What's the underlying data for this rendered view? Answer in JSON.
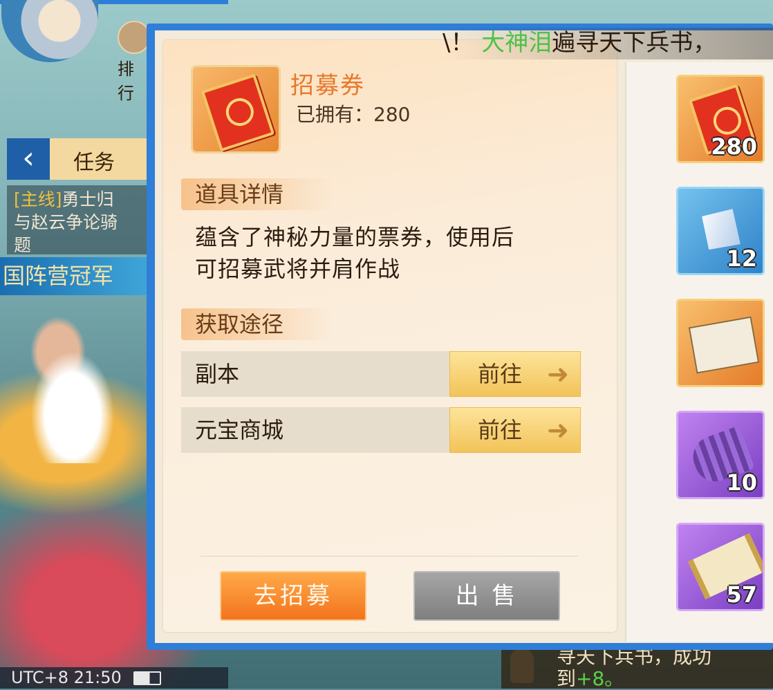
{
  "background": {
    "rank_label": "排行",
    "quest_tab_label": "任务",
    "quest_text_tag": "[主线]",
    "quest_text_line1": "勇士归",
    "quest_text_line2": "与赵云争论骑",
    "quest_text_line3": "题",
    "camp_banner": "国阵营冠军",
    "status_time": "UTC+8 21:50",
    "chat_text_line1": "寻天下兵书，成功",
    "chat_text_line2_prefix": "到",
    "chat_text_line2_value": "+8。"
  },
  "marquee": {
    "prefix": "\\！",
    "player_name": "大神泪",
    "message": "遍寻天下兵书，"
  },
  "item": {
    "name": "招募券",
    "owned_label": "已拥有：",
    "owned_count": "280",
    "detail_heading": "道具详情",
    "description_line1": "蕴含了神秘力量的票券，使用后",
    "description_line2": "可招募武将并肩作战",
    "source_heading": "获取途径",
    "routes": [
      {
        "name": "副本",
        "action": "前往"
      },
      {
        "name": "元宝商城",
        "action": "前往"
      }
    ]
  },
  "buttons": {
    "recruit": "去招募",
    "sell": "出 售"
  },
  "inventory": [
    {
      "icon": "recruit-ticket-icon",
      "count": "280",
      "rarity": "orange"
    },
    {
      "icon": "crystal-gem-icon",
      "count": "12",
      "rarity": "blue"
    },
    {
      "icon": "war-book-icon",
      "count": "",
      "rarity": "orange"
    },
    {
      "icon": "purple-scroll-icon",
      "count": "10",
      "rarity": "purple"
    },
    {
      "icon": "open-scroll-icon",
      "count": "57",
      "rarity": "purple"
    }
  ],
  "colors": {
    "frame_blue": "#2f7ed8",
    "title_orange": "#e7782a",
    "recruit_button": "#f3721c",
    "go_button": "#f2c35a"
  }
}
